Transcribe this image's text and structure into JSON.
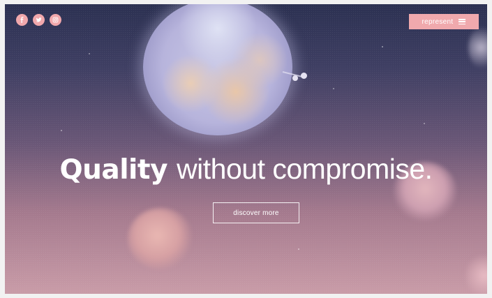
{
  "social": {
    "items": [
      {
        "name": "facebook-icon",
        "glyph": "f"
      },
      {
        "name": "twitter-icon",
        "glyph": "twitter-bird"
      },
      {
        "name": "instagram-icon",
        "glyph": "instagram-camera"
      }
    ],
    "color": "#f1a8ac"
  },
  "menu": {
    "label": "represent",
    "icon": "hamburger-icon",
    "color": "#f0a9ad"
  },
  "hero": {
    "headline_strong": "Quality",
    "headline_rest": "without compromise.",
    "cta_label": "discover more"
  }
}
